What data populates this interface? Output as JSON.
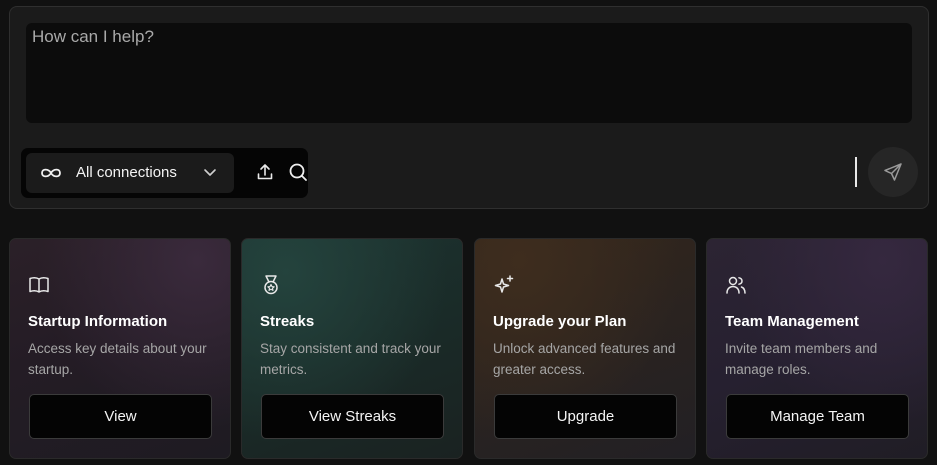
{
  "composer": {
    "placeholder": "How can I help?",
    "connections_label": "All connections",
    "icons": {
      "connections": "infinity-icon",
      "dropdown": "chevron-down-icon",
      "upload": "upload-icon",
      "search": "search-icon",
      "send": "send-icon"
    }
  },
  "cards": [
    {
      "icon": "book-open-icon",
      "title": "Startup Information",
      "description": "Access key details about your startup.",
      "button": "View"
    },
    {
      "icon": "medal-icon",
      "title": "Streaks",
      "description": "Stay consistent and track your metrics.",
      "button": "View Streaks"
    },
    {
      "icon": "sparkles-icon",
      "title": "Upgrade your Plan",
      "description": "Unlock advanced features and greater access.",
      "button": "Upgrade"
    },
    {
      "icon": "users-icon",
      "title": "Team Management",
      "description": "Invite team members and manage roles.",
      "button": "Manage Team"
    }
  ],
  "colors": {
    "background": "#111111",
    "composer_bg": "#1b1b1b",
    "input_bg": "#0c0c0c",
    "button_bg": "#040404"
  }
}
